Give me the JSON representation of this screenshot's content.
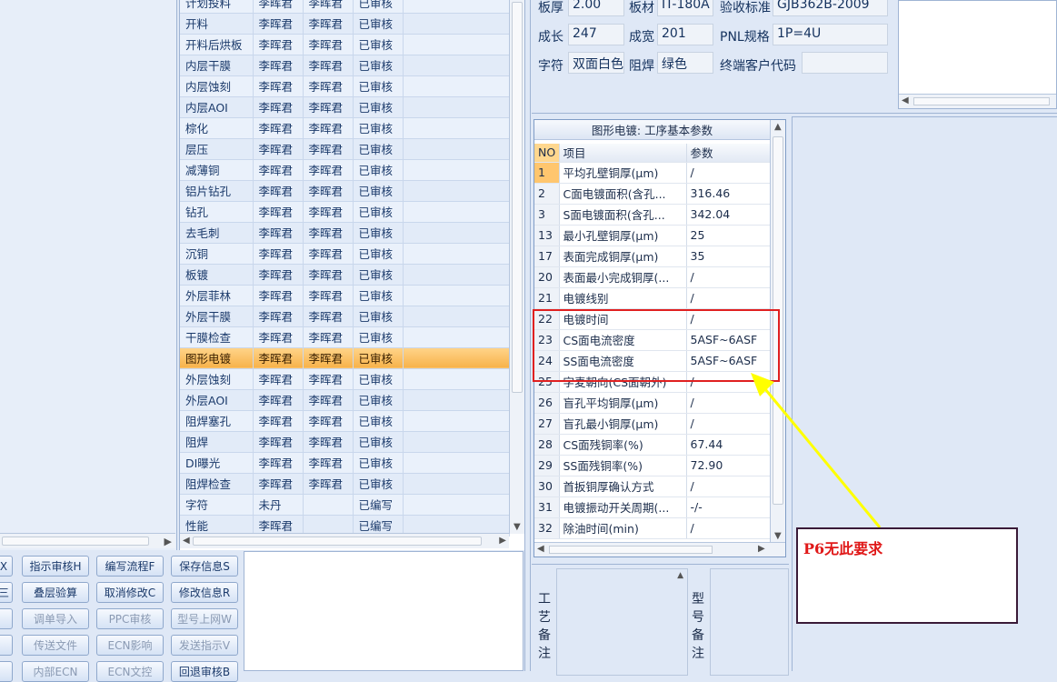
{
  "process_table": {
    "rows": [
      {
        "process": "计划投料",
        "user1": "李晖君",
        "user2": "李晖君",
        "status": "已审核"
      },
      {
        "process": "开料",
        "user1": "李晖君",
        "user2": "李晖君",
        "status": "已审核"
      },
      {
        "process": "开料后烘板",
        "user1": "李晖君",
        "user2": "李晖君",
        "status": "已审核"
      },
      {
        "process": "内层干膜",
        "user1": "李晖君",
        "user2": "李晖君",
        "status": "已审核"
      },
      {
        "process": "内层蚀刻",
        "user1": "李晖君",
        "user2": "李晖君",
        "status": "已审核"
      },
      {
        "process": "内层AOI",
        "user1": "李晖君",
        "user2": "李晖君",
        "status": "已审核"
      },
      {
        "process": "棕化",
        "user1": "李晖君",
        "user2": "李晖君",
        "status": "已审核"
      },
      {
        "process": "层压",
        "user1": "李晖君",
        "user2": "李晖君",
        "status": "已审核"
      },
      {
        "process": "减薄铜",
        "user1": "李晖君",
        "user2": "李晖君",
        "status": "已审核"
      },
      {
        "process": "铝片钻孔",
        "user1": "李晖君",
        "user2": "李晖君",
        "status": "已审核"
      },
      {
        "process": "钻孔",
        "user1": "李晖君",
        "user2": "李晖君",
        "status": "已审核"
      },
      {
        "process": "去毛刺",
        "user1": "李晖君",
        "user2": "李晖君",
        "status": "已审核"
      },
      {
        "process": "沉铜",
        "user1": "李晖君",
        "user2": "李晖君",
        "status": "已审核"
      },
      {
        "process": "板镀",
        "user1": "李晖君",
        "user2": "李晖君",
        "status": "已审核"
      },
      {
        "process": "外层菲林",
        "user1": "李晖君",
        "user2": "李晖君",
        "status": "已审核"
      },
      {
        "process": "外层干膜",
        "user1": "李晖君",
        "user2": "李晖君",
        "status": "已审核"
      },
      {
        "process": "干膜检查",
        "user1": "李晖君",
        "user2": "李晖君",
        "status": "已审核"
      },
      {
        "process": "图形电镀",
        "user1": "李晖君",
        "user2": "李晖君",
        "status": "已审核"
      },
      {
        "process": "外层蚀刻",
        "user1": "李晖君",
        "user2": "李晖君",
        "status": "已审核"
      },
      {
        "process": "外层AOI",
        "user1": "李晖君",
        "user2": "李晖君",
        "status": "已审核"
      },
      {
        "process": "阻焊塞孔",
        "user1": "李晖君",
        "user2": "李晖君",
        "status": "已审核"
      },
      {
        "process": "阻焊",
        "user1": "李晖君",
        "user2": "李晖君",
        "status": "已审核"
      },
      {
        "process": "DI曝光",
        "user1": "李晖君",
        "user2": "李晖君",
        "status": "已审核"
      },
      {
        "process": "阻焊检查",
        "user1": "李晖君",
        "user2": "李晖君",
        "status": "已审核"
      },
      {
        "process": "字符",
        "user1": "未丹",
        "user2": "",
        "status": "已编写"
      },
      {
        "process": "性能",
        "user1": "李晖君",
        "user2": "",
        "status": "已编写"
      }
    ]
  },
  "buttons": {
    "row1": [
      "X",
      "指示审核H",
      "编写流程F",
      "保存信息S"
    ],
    "row2": [
      "三",
      "叠层验算",
      "取消修改C",
      "修改信息R"
    ],
    "row3": [
      "",
      "调单导入",
      "PPC审核",
      "型号上网W"
    ],
    "row4": [
      "",
      "传送文件",
      "ECN影响",
      "发送指示V"
    ],
    "row5": [
      "",
      "内部ECN",
      "ECN文控",
      "回退审核B"
    ]
  },
  "info": {
    "board_thickness_label": "板厚",
    "board_thickness": "2.00",
    "material_label": "板材",
    "material": "IT-180A",
    "acceptance_label": "验收标准",
    "acceptance": "GJB362B-2009",
    "length_label": "成长",
    "length": "247",
    "width_label": "成宽",
    "width": "201",
    "pnl_label": "PNL规格",
    "pnl": "1P=4U",
    "legend_label": "字符",
    "legend": "双面白色",
    "mask_label": "阻焊",
    "mask": "绿色",
    "customer_code_label": "终端客户代码",
    "customer_code": ""
  },
  "param_grid": {
    "title": "图形电镀: 工序基本参数",
    "headers": {
      "no": "NO",
      "item": "项目",
      "value": "参数"
    },
    "rows": [
      {
        "no": "1",
        "item": "平均孔壁铜厚(μm)",
        "value": "/"
      },
      {
        "no": "2",
        "item": "C面电镀面积(含孔...",
        "value": "316.46"
      },
      {
        "no": "3",
        "item": "S面电镀面积(含孔...",
        "value": "342.04"
      },
      {
        "no": "13",
        "item": "最小孔壁铜厚(μm)",
        "value": "25"
      },
      {
        "no": "17",
        "item": "表面完成铜厚(μm)",
        "value": "35"
      },
      {
        "no": "20",
        "item": "表面最小完成铜厚(...",
        "value": "/"
      },
      {
        "no": "21",
        "item": "电镀线别",
        "value": "/"
      },
      {
        "no": "22",
        "item": "电镀时间",
        "value": "/"
      },
      {
        "no": "23",
        "item": "CS面电流密度",
        "value": "5ASF~6ASF"
      },
      {
        "no": "24",
        "item": "SS面电流密度",
        "value": "5ASF~6ASF"
      },
      {
        "no": "25",
        "item": "字麦朝向(CS面朝外)",
        "value": "/"
      },
      {
        "no": "26",
        "item": "盲孔平均铜厚(μm)",
        "value": "/"
      },
      {
        "no": "27",
        "item": "盲孔最小铜厚(μm)",
        "value": "/"
      },
      {
        "no": "28",
        "item": "CS面残铜率(%)",
        "value": "67.44"
      },
      {
        "no": "29",
        "item": "SS面残铜率(%)",
        "value": "72.90"
      },
      {
        "no": "30",
        "item": "首扳铜厚确认方式",
        "value": "/"
      },
      {
        "no": "31",
        "item": "电镀振动开关周期(...",
        "value": "-/-"
      },
      {
        "no": "32",
        "item": "除油时间(min)",
        "value": "/"
      }
    ]
  },
  "remarks": {
    "process_remark_label": "工艺备注",
    "model_remark_label": "型号备注"
  },
  "annotation": {
    "callout_text": "P6无此要求",
    "highlight_color": "#e02020",
    "arrow_color": "#ffff00"
  }
}
